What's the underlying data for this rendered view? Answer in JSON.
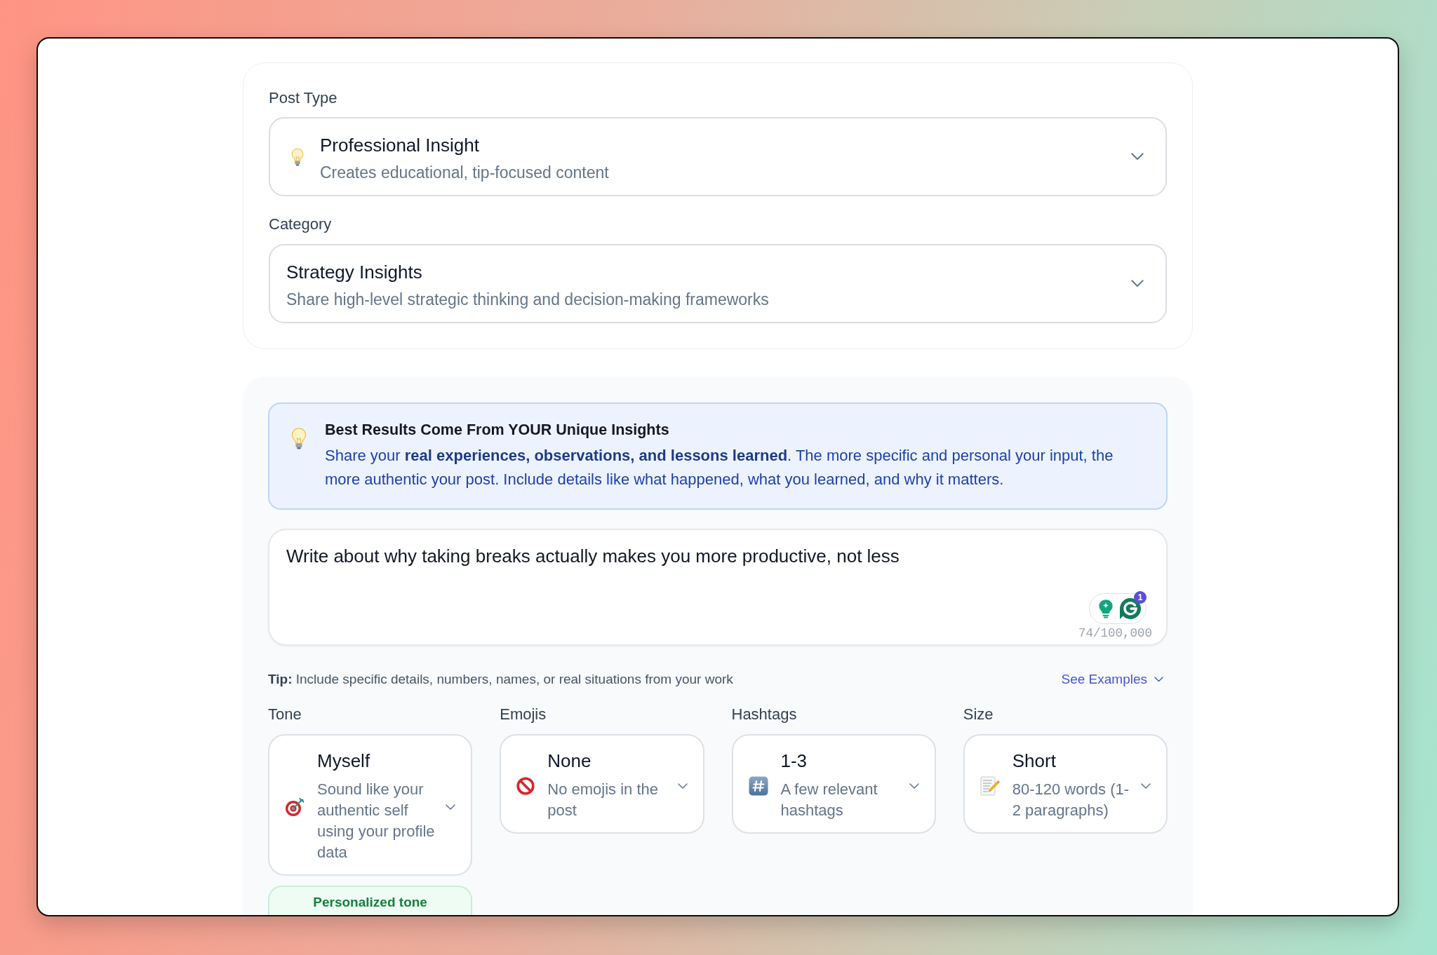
{
  "post_settings": {
    "post_type": {
      "label": "Post Type",
      "value": "Professional Insight",
      "description": "Creates educational, tip-focused content"
    },
    "category": {
      "label": "Category",
      "value": "Strategy Insights",
      "description": "Share high-level strategic thinking and decision-making frameworks"
    }
  },
  "insight_callout": {
    "title": "Best Results Come From YOUR Unique Insights",
    "text": "Share your **real experiences, observations, and lessons learned**. The more specific and personal your input, the more authentic your post. Include details like what happened, what you learned, and why it matters."
  },
  "prompt": {
    "value": "Write about why taking breaks actually makes you more productive, not less",
    "counter": "74/100,000",
    "assistant_badge": "1"
  },
  "tip": {
    "text": "**Tip:** Include specific details, numbers, names, or real situations from your work",
    "link": "See Examples"
  },
  "options": [
    {
      "label": "Tone",
      "value": "Myself",
      "description": "Sound like your authentic self using your profile data",
      "note": "Personalized tone"
    },
    {
      "label": "Emojis",
      "value": "None",
      "description": "No emojis in the post"
    },
    {
      "label": "Hashtags",
      "value": "1-3",
      "description": "A few relevant hashtags"
    },
    {
      "label": "Size",
      "value": "Short",
      "description": "80-120 words (1-2 paragraphs)"
    }
  ]
}
